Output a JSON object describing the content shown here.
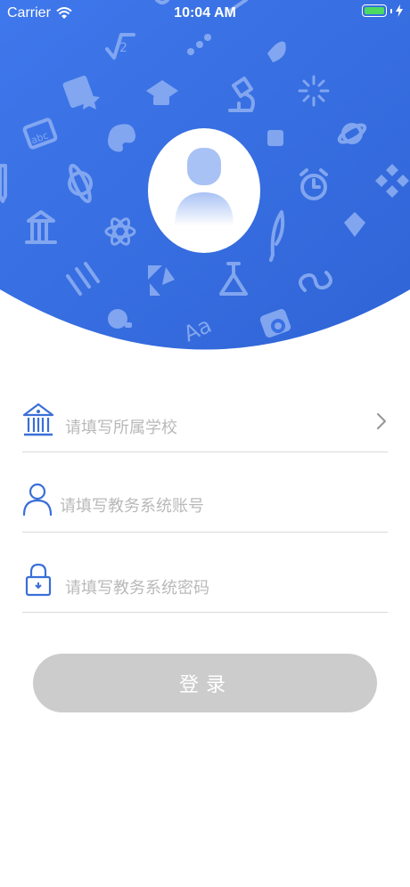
{
  "status_bar": {
    "carrier": "Carrier",
    "time": "10:04 AM"
  },
  "colors": {
    "header_blue": "#3a72e6",
    "icon_blue": "#3a6fd8",
    "battery_green": "#4cd964",
    "button_disabled": "#cccccc"
  },
  "form": {
    "school": {
      "placeholder": "请填写所属学校",
      "icon": "school-building-icon"
    },
    "account": {
      "placeholder": "请填写教务系统账号",
      "icon": "user-icon"
    },
    "password": {
      "placeholder": "请填写教务系统密码",
      "icon": "lock-icon"
    }
  },
  "login_button": {
    "label": "登录"
  }
}
